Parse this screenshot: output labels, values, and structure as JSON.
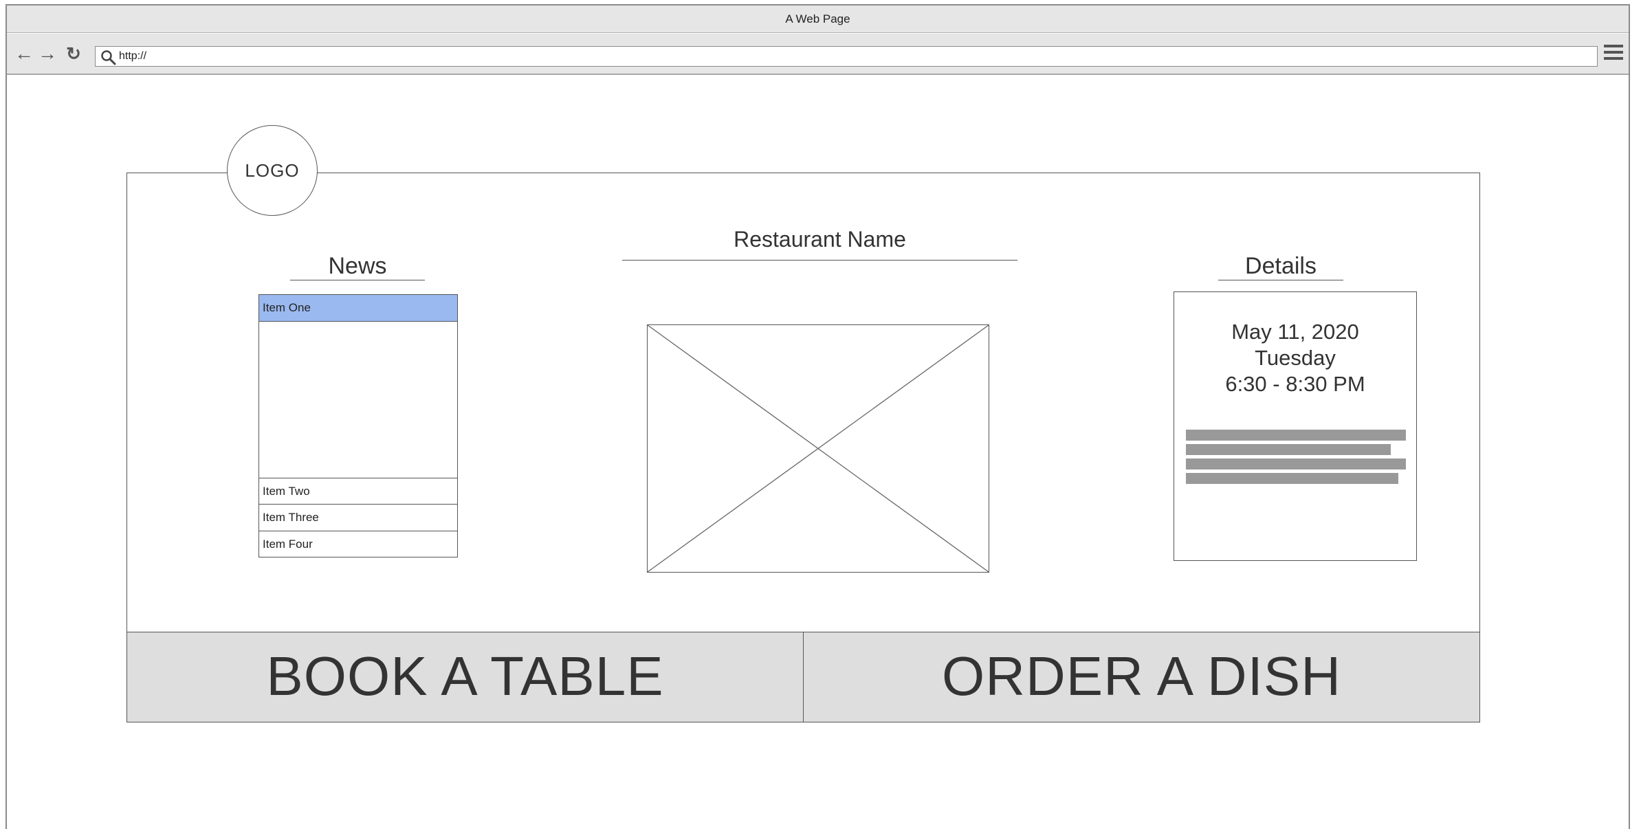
{
  "browser": {
    "window_title": "A Web Page",
    "url": "http://",
    "icons": [
      "back-arrow-icon",
      "forward-arrow-icon",
      "reload-icon",
      "search-icon",
      "hamburger-menu-icon"
    ]
  },
  "page": {
    "logo_text": "LOGO",
    "restaurant_name": "Restaurant Name",
    "news": {
      "heading": "News",
      "items": [
        {
          "label": "Item One",
          "selected": true
        },
        {
          "label": "Item Two",
          "selected": false
        },
        {
          "label": "Item Three",
          "selected": false
        },
        {
          "label": "Item Four",
          "selected": false
        }
      ]
    },
    "details": {
      "heading": "Details",
      "date": "May 11, 2020",
      "day": "Tuesday",
      "time": "6:30 - 8:30 PM"
    },
    "actions": {
      "book_label": "BOOK A TABLE",
      "order_label": "ORDER A DISH"
    }
  },
  "colors": {
    "selected_item": "#9ab9f0",
    "button_bg": "#dedede",
    "chrome_bg": "#e6e6e6"
  }
}
